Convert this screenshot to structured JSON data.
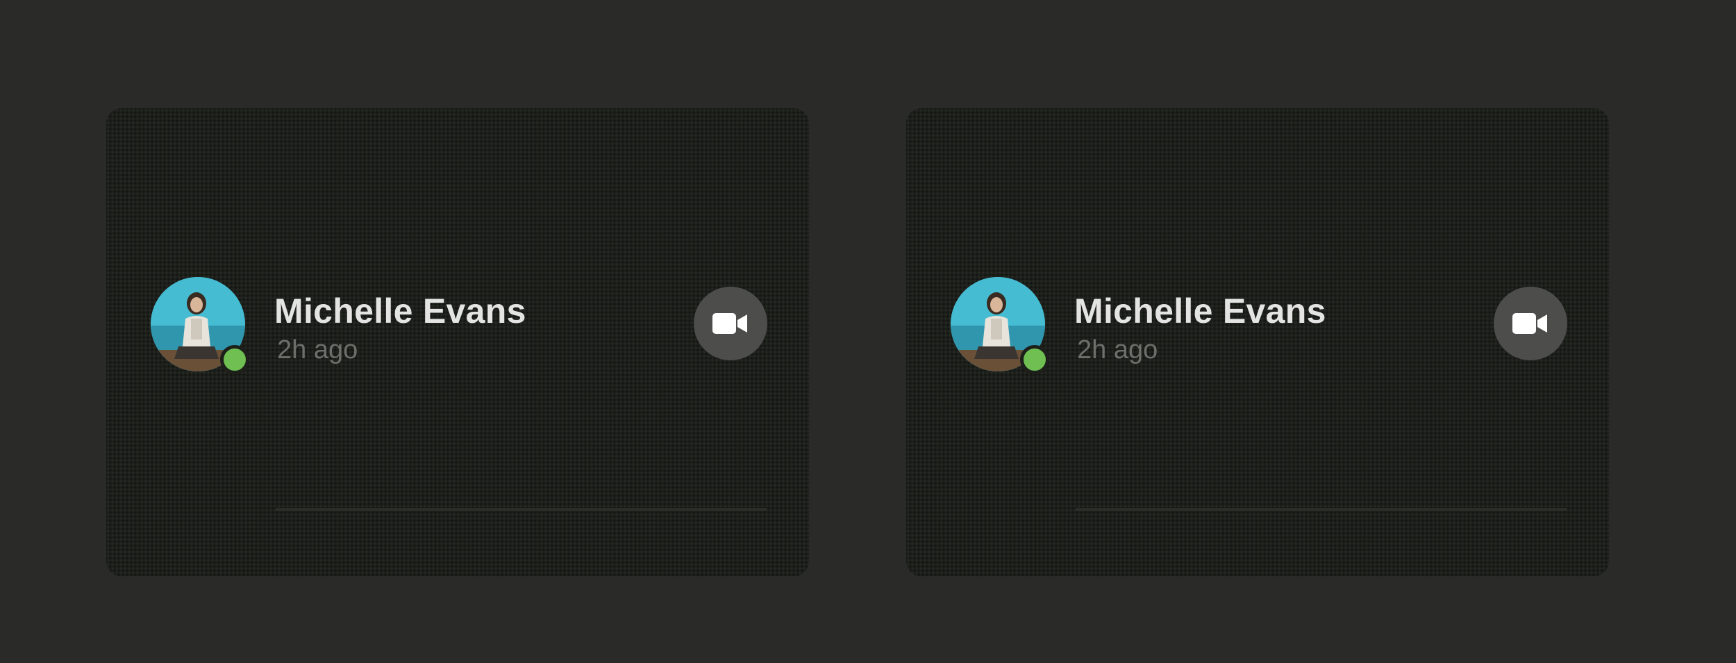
{
  "cards": [
    {
      "contact": {
        "name": "Michelle Evans",
        "time": "2h ago",
        "status": "online",
        "status_color": "#6fbf52"
      },
      "action": {
        "icon": "video-camera-icon"
      }
    },
    {
      "contact": {
        "name": "Michelle Evans",
        "time": "2h ago",
        "status": "online",
        "status_color": "#6fbf52"
      },
      "action": {
        "icon": "video-camera-icon"
      }
    }
  ],
  "colors": {
    "background": "#2a2a29",
    "card": "#1d1f1b",
    "name_text": "#e4e4e2",
    "time_text": "#6e6f6b",
    "button": "#4d4e4b"
  }
}
